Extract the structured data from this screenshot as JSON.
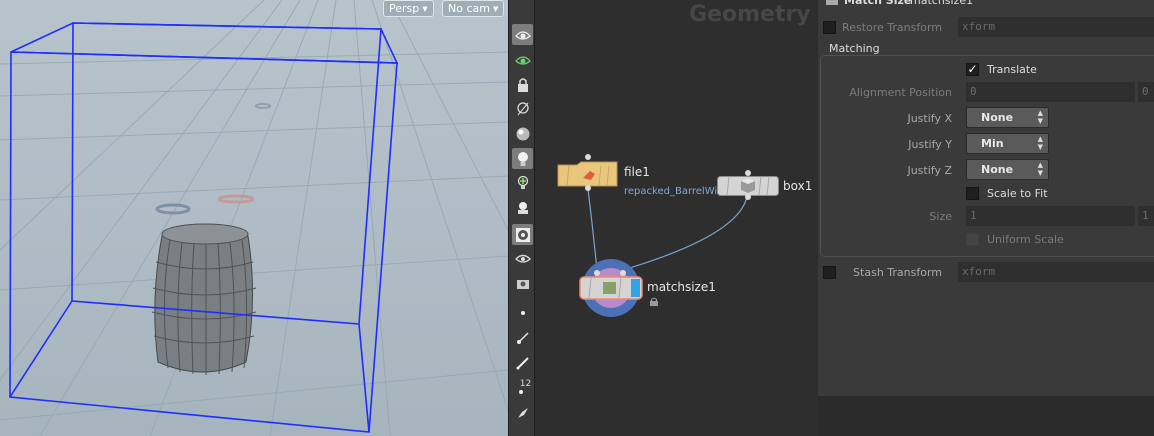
{
  "viewport": {
    "view_label": "Persp",
    "cam_label": "No cam"
  },
  "network": {
    "title": "Geometry",
    "nodes": {
      "file": {
        "name": "file1",
        "path": "repacked_BarrelWithHoles.obj"
      },
      "box": {
        "name": "box1"
      },
      "match": {
        "name": "matchsize1"
      }
    }
  },
  "params": {
    "header": {
      "type": "Match Size",
      "node_name": "matchsize1"
    },
    "restore_transform": {
      "label": "Restore Transform",
      "value": "xform",
      "checked": false
    },
    "matching": {
      "title": "Matching",
      "translate": {
        "label": "Translate",
        "checked": true
      },
      "alignment_position": {
        "label": "Alignment Position",
        "x": "0",
        "y": "0"
      },
      "justify_x": {
        "label": "Justify X",
        "value": "None"
      },
      "justify_y": {
        "label": "Justify Y",
        "value": "Min"
      },
      "justify_z": {
        "label": "Justify Z",
        "value": "None"
      },
      "scale_to_fit": {
        "label": "Scale to Fit",
        "checked": false
      },
      "size": {
        "label": "Size",
        "x": "1",
        "y": "1"
      },
      "uniform_scale": {
        "label": "Uniform Scale",
        "checked": false
      }
    },
    "stash_transform": {
      "label": "Stash Transform",
      "value": "xform",
      "checked": false
    }
  },
  "toolbar": {
    "icons": [
      "view-tool-icon",
      "select-tool-icon",
      "lock-icon",
      "ghost-icon",
      "sphere-shading-icon",
      "light-bulb-icon",
      "light-add-icon",
      "camera-icon",
      "texture-display-icon",
      "eye-visibility-icon",
      "snapshot-icon",
      "point-display-icon",
      "normal-display-icon",
      "brush-icon",
      "point-number-icon",
      "paint-icon"
    ],
    "point_number_text": "12"
  },
  "colors": {
    "bbox": "#1f2dff",
    "grid": "#95a8b3",
    "node_file": "#e8c77c",
    "node_match_ring": "#6f8fcf",
    "node_match_inner": "#b88ac8"
  }
}
